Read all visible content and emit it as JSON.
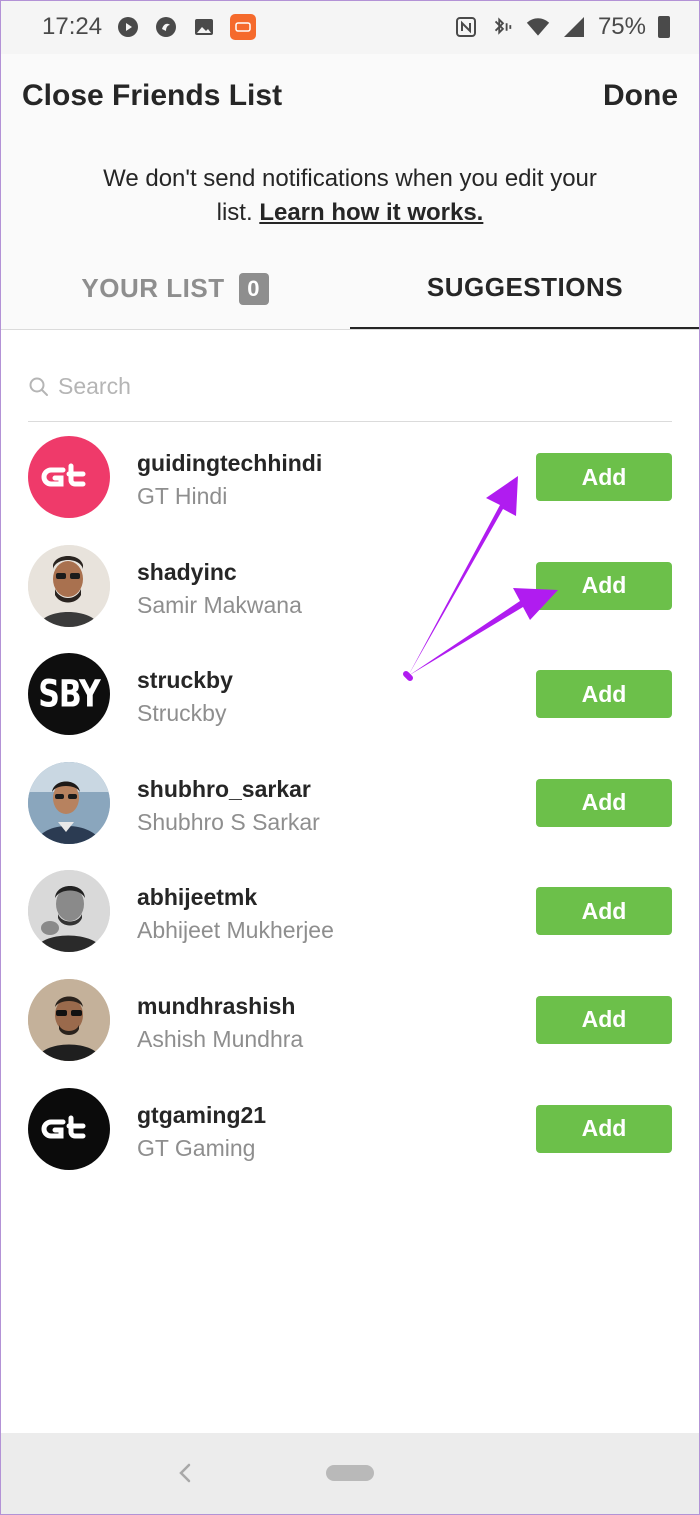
{
  "status_bar": {
    "time": "17:24",
    "battery": "75%"
  },
  "header": {
    "title": "Close Friends List",
    "done_label": "Done"
  },
  "notice": {
    "text": "We don't send notifications when you edit your list. ",
    "link": "Learn how it works."
  },
  "tabs": {
    "your_list": "YOUR LIST",
    "your_list_count": "0",
    "suggestions": "SUGGESTIONS"
  },
  "search": {
    "placeholder": "Search",
    "value": ""
  },
  "suggestions": [
    {
      "username": "guidingtechhindi",
      "name": "GT Hindi",
      "avatar": "gt-logo-pink",
      "action": "Add"
    },
    {
      "username": "shadyinc",
      "name": "Samir Makwana",
      "avatar": "person-photo",
      "action": "Add"
    },
    {
      "username": "struckby",
      "name": "Struckby",
      "avatar": "sby-logo",
      "action": "Add",
      "avatar_text": "SBY"
    },
    {
      "username": "shubhro_sarkar",
      "name": "Shubhro S Sarkar",
      "avatar": "person-photo",
      "action": "Add"
    },
    {
      "username": "abhijeetmk",
      "name": "Abhijeet Mukherjee",
      "avatar": "person-photo",
      "action": "Add"
    },
    {
      "username": "mundhrashish",
      "name": "Ashish Mundhra",
      "avatar": "person-photo",
      "action": "Add"
    },
    {
      "username": "gtgaming21",
      "name": "GT Gaming",
      "avatar": "gt-logo-black",
      "action": "Add"
    }
  ],
  "colors": {
    "add_button": "#6cc04a",
    "annotation_arrow": "#b01cf0",
    "gt_pink": "#f0386b"
  }
}
